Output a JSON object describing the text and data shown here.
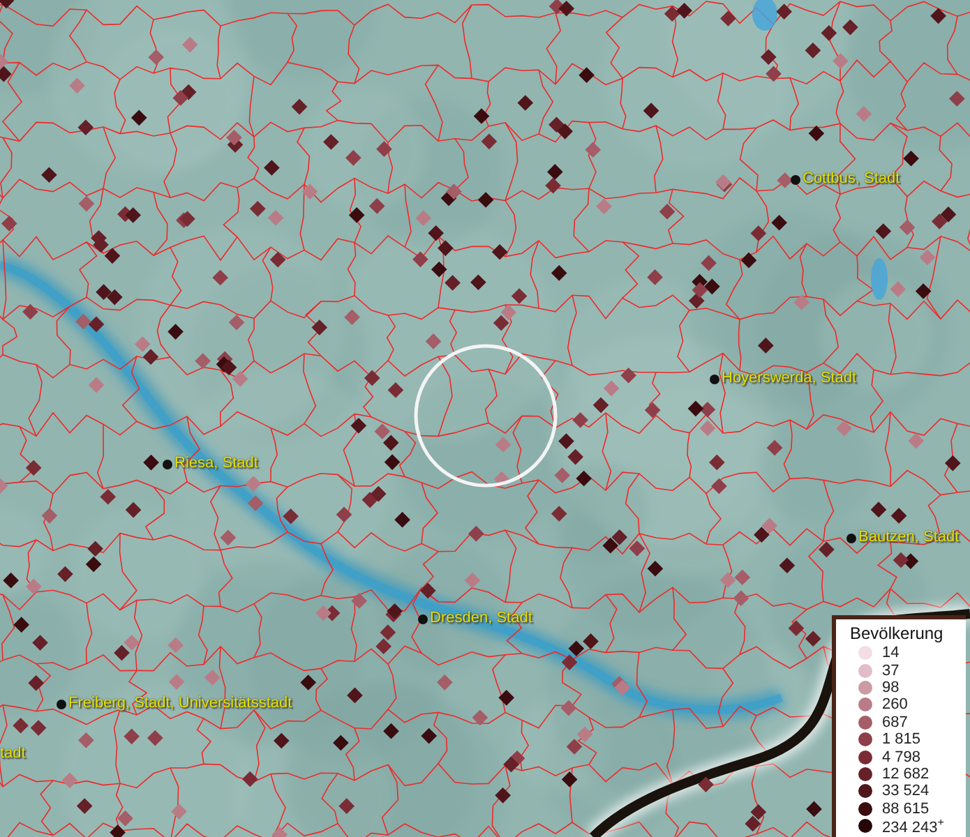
{
  "map": {
    "places": [
      {
        "name": "Cottbus, Stadt"
      },
      {
        "name": "Hoyerswerda, Stadt"
      },
      {
        "name": "Riesa, Stadt"
      },
      {
        "name": "Bautzen, Stadt"
      },
      {
        "name": "Dresden, Stadt"
      },
      {
        "name": "Freiberg, Stadt, Universitätsstadt"
      },
      {
        "name": "tadt"
      }
    ]
  },
  "legend": {
    "title": "Bevölkerung",
    "items": [
      {
        "label": "14",
        "color": "#f3dde6"
      },
      {
        "label": "37",
        "color": "#e2bcc8"
      },
      {
        "label": "98",
        "color": "#cc9aa4"
      },
      {
        "label": "260",
        "color": "#b97c86"
      },
      {
        "label": "687",
        "color": "#a55d67"
      },
      {
        "label": "1 815",
        "color": "#8f3f49"
      },
      {
        "label": "4 798",
        "color": "#7a2c35"
      },
      {
        "label": "12 682",
        "color": "#652028"
      },
      {
        "label": "33 524",
        "color": "#4f151b"
      },
      {
        "label": "88 615",
        "color": "#3a0c10"
      },
      {
        "label": "234 243$^{+}$",
        "color": "#250508"
      }
    ]
  }
}
